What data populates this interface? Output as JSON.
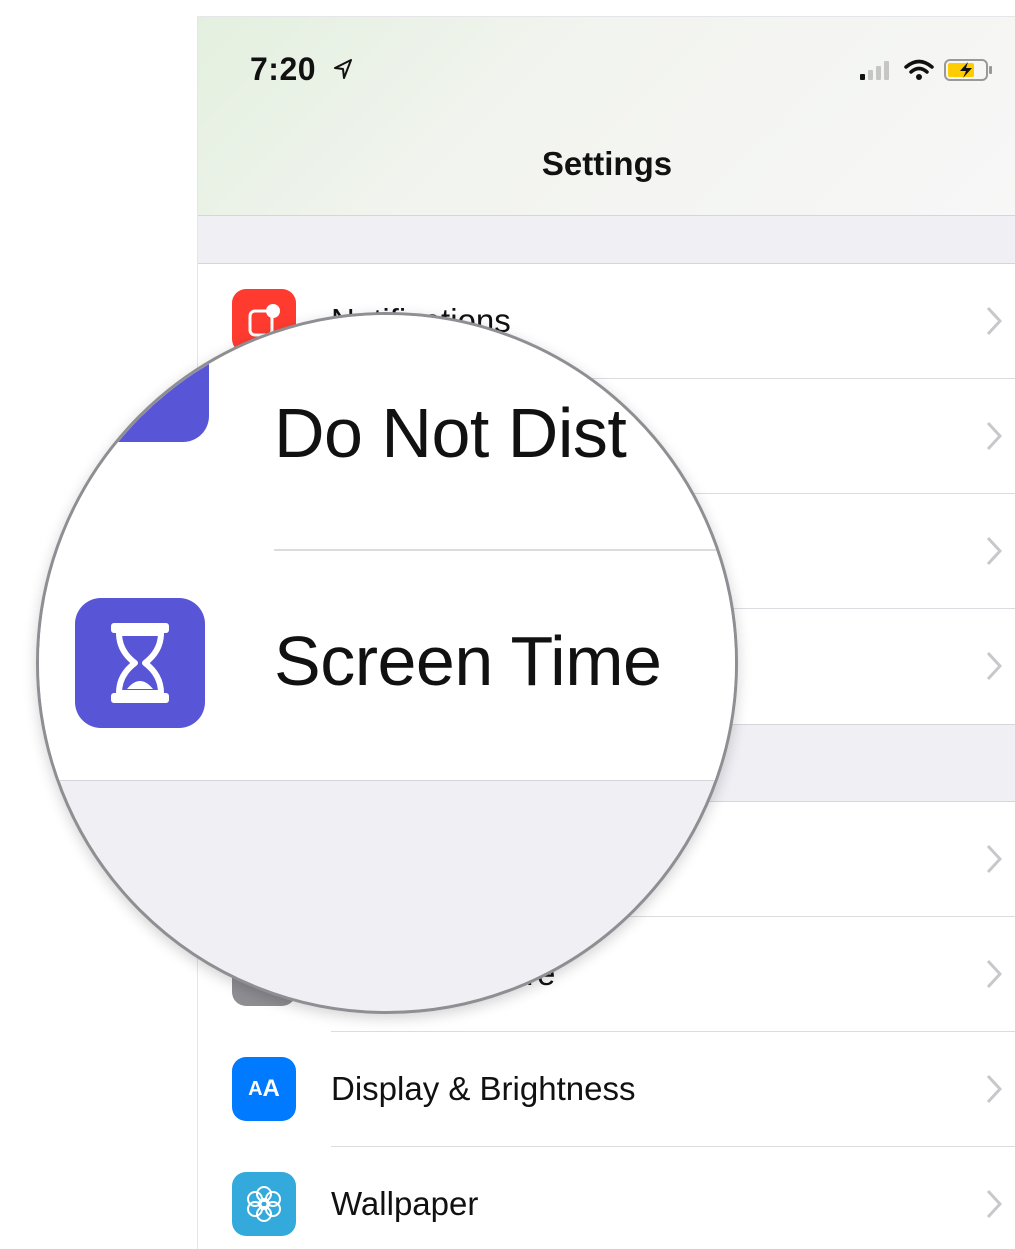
{
  "status_bar": {
    "time": "7:20",
    "icons": [
      "location-arrow-icon",
      "cellular-signal-icon",
      "wifi-icon",
      "battery-charging-icon"
    ]
  },
  "nav": {
    "title": "Settings"
  },
  "group1": {
    "items": [
      {
        "label": "Notifications",
        "icon": "notifications-icon",
        "color": "#ff3b30"
      },
      {
        "label": "",
        "icon": "do-not-disturb-icon",
        "color": "#5856d6"
      },
      {
        "label": "",
        "icon": "",
        "color": ""
      },
      {
        "label": "",
        "icon": "screen-time-icon",
        "color": "#5856d6"
      }
    ]
  },
  "group2": {
    "items": [
      {
        "label": "",
        "icon": "",
        "color": ""
      },
      {
        "label": "re",
        "icon": "control-centre-icon",
        "color": "#8e8e93"
      },
      {
        "label": "Display & Brightness",
        "icon": "display-brightness-icon",
        "color": "#007aff",
        "icon_text": "AA"
      },
      {
        "label": "Wallpaper",
        "icon": "wallpaper-icon",
        "color": "#34aadc"
      }
    ]
  },
  "magnifier": {
    "row1_label": "Do Not Dist",
    "row2_label": "Screen Time"
  },
  "colors": {
    "background": "#efeff4",
    "separator": "#dcdce0",
    "chevron": "#c7c7cc",
    "accent_purple": "#5856d6"
  }
}
